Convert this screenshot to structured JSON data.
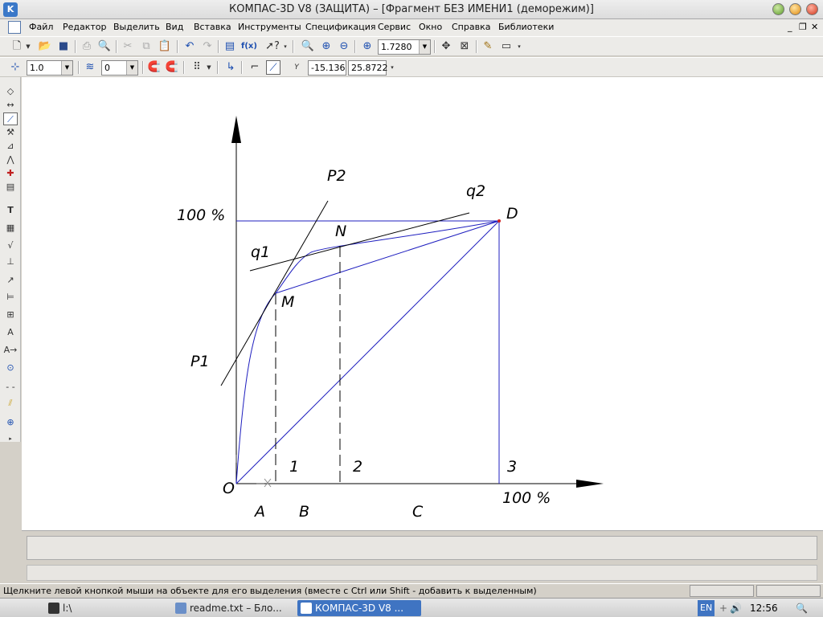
{
  "window": {
    "title": "КОМПАС-3D V8 (ЗАЩИТА) – [Фрагмент БЕЗ ИМЕНИ1 (деморежим)]"
  },
  "menu": {
    "items": [
      "Файл",
      "Редактор",
      "Выделить",
      "Вид",
      "Вставка",
      "Инструменты",
      "Спецификация",
      "Сервис",
      "Окно",
      "Справка",
      "Библиотеки"
    ]
  },
  "toolbar": {
    "zoom_value": "1.7280",
    "line_scale": "1.0",
    "layer": "0",
    "coord_label": "Y",
    "coord_x": "-15.136",
    "coord_y": "25.8722"
  },
  "drawing": {
    "labels": {
      "percent_top": "100 %",
      "percent_right": "100 %",
      "P1": "P1",
      "P2": "P2",
      "q1": "q1",
      "q2": "q2",
      "D": "D",
      "N": "N",
      "M": "M",
      "O": "O",
      "one": "1",
      "two": "2",
      "three": "3",
      "A": "A",
      "B": "B",
      "C": "C"
    },
    "colors": {
      "line_black": "#000000",
      "line_blue": "#1f1fbf"
    }
  },
  "status": {
    "message": "Щелкните левой кнопкой мыши на объекте для его выделения (вместе с Ctrl или Shift - добавить к выделенным)"
  },
  "taskbar": {
    "terminal": "l:\\",
    "readme": "readme.txt – Бло...",
    "kompas": "КОМПАС-3D V8 ...",
    "lang": "EN",
    "time": "12:56"
  }
}
